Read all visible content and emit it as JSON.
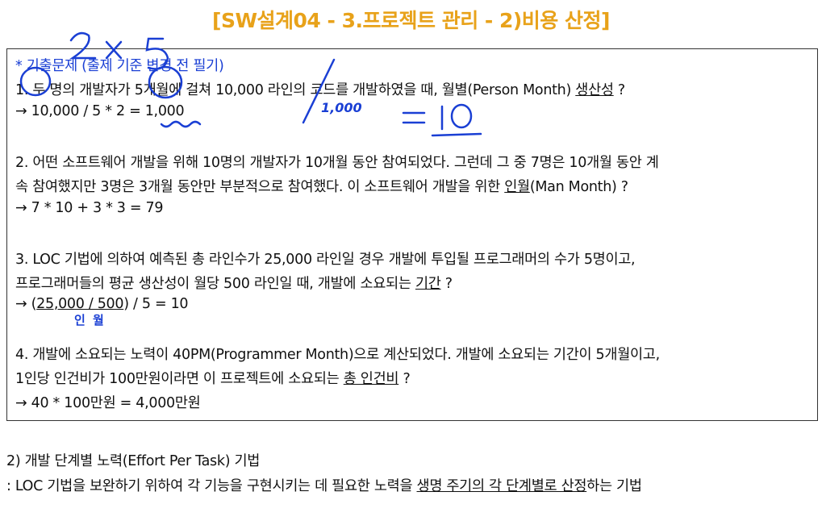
{
  "title": "[SW설계04 - 3.프로젝트 관리 - 2)비용 산정]",
  "note": "* 기출문제 (출제 기준 변경 전 필기)",
  "q1": {
    "line1_pre": "1. 두 명의 개발자가 5개월에 걸쳐 10,000 라인의 코드를 개발하였을 때, 월별(Person Month) ",
    "line1_u": "생산성",
    "line1_post": " ?",
    "ans_pre": "→ 10,000 / 5 * 2 = ",
    "ans_u": "1,000"
  },
  "q2": {
    "line1": "2. 어떤 소프트웨어 개발을 위해 10명의 개발자가 10개월 동안 참여되었다. 그런데 그 중 7명은 10개월 동안 계",
    "line2_pre": "속 참여했지만 3명은 3개월 동안만 부분적으로 참여했다. 이 소프트웨어 개발을 위한 ",
    "line2_u": "인월",
    "line2_post": "(Man Month) ?",
    "ans": "→ 7 * 10 + 3 * 3 = 79"
  },
  "q3": {
    "line1": "3. LOC 기법에 의하여 예측된 총 라인수가 25,000 라인일 경우 개발에 투입될 프로그래머의 수가 5명이고,",
    "line2_pre": "프로그래머들의 평균 생산성이 월당 500 라인일 때, 개발에 소요되는 ",
    "line2_u": "기간",
    "line2_post": " ?",
    "ans_pre": "→ (",
    "ans_u": "25,000 / 500",
    "ans_post": ") / 5 = 10",
    "handwritten_sub": "인 월"
  },
  "q4": {
    "line1": "4. 개발에 소요되는 노력이 40PM(Programmer Month)으로 계산되었다. 개발에 소요되는 기간이 5개월이고,",
    "line2_pre": "1인당 인건비가 100만원이라면 이 프로젝트에 소요되는 ",
    "line2_u": "총 인건비",
    "line2_post": " ?",
    "ans": "→ 40 * 100만원 = 4,000만원"
  },
  "handwriting": {
    "fraction_denominator": "1,000",
    "result": "= 10",
    "ink_color": "#1a3fd4"
  },
  "section2": {
    "heading": "2) 개발 단계별 노력(Effort Per Task) 기법",
    "desc_pre": ": LOC 기법을 보완하기 위하여 각 기능을 구현시키는 데 필요한 노력을 ",
    "desc_u": "생명 주기의 각 단계별로 산정",
    "desc_post": "하는 기법"
  }
}
